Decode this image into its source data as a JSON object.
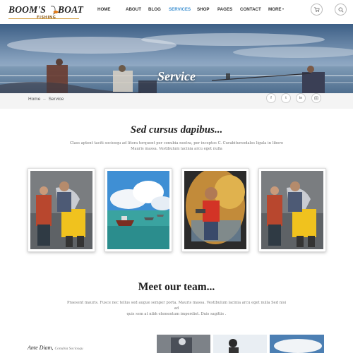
{
  "header": {
    "logo": {
      "left": "BOOM'S",
      "right": "BOAT",
      "sub": "FISHING"
    },
    "nav": [
      {
        "label": "HOME",
        "active": false
      },
      {
        "label": "ABOUT",
        "active": false
      },
      {
        "label": "BLOG",
        "active": false
      },
      {
        "label": "SERVICES",
        "active": true
      },
      {
        "label": "SHOP",
        "active": false
      },
      {
        "label": "PAGES",
        "active": false
      },
      {
        "label": "CONTACT",
        "active": false
      },
      {
        "label": "MORE",
        "active": false,
        "dropdown": true
      }
    ],
    "cart_icon": "shopping-cart-icon",
    "search_icon": "search-icon"
  },
  "banner": {
    "title": "Service"
  },
  "breadcrumb": {
    "home": "Home",
    "separator": "–",
    "current": "Service"
  },
  "social": [
    "facebook-icon",
    "twitter-icon",
    "linkedin-icon",
    "instagram-icon"
  ],
  "section": {
    "title": "Sed cursus dapibus...",
    "text_line1": "Class aptent taciti sociosqu ad litora torquent per conubia nostra, per inceptos C. Curabitursodales ligula in libero",
    "text_line2": "Mauris massa. Vestibulum lacinia arcu eget nulla"
  },
  "gallery": [
    "fisherman-photo",
    "boats-photo",
    "boy-fishing-photo",
    "fisherman-photo"
  ],
  "team": {
    "title": "Meet our team...",
    "text_line1": "Praesent mauris. Fusce nec tellus sed augue semper porta. Mauris massa. Vestibulum lacinia arcu eget nulla Sed nisi ad",
    "text_line2": "quis sem at nibh elementum imperdiet. Duis sagittis .",
    "member": {
      "name": "Ante Diam,",
      "role": "Conubia Sociosqu"
    }
  },
  "colors": {
    "accent": "#3b8fd0",
    "text": "#222222",
    "muted": "#777777",
    "logo_line": "#d09a3a"
  }
}
